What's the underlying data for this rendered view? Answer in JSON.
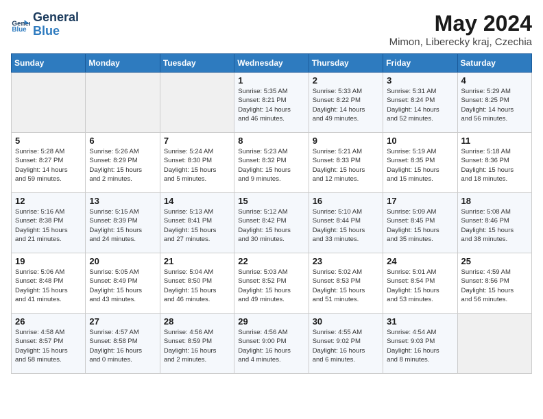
{
  "header": {
    "logo_line1": "General",
    "logo_line2": "Blue",
    "month_year": "May 2024",
    "location": "Mimon, Liberecky kraj, Czechia"
  },
  "weekdays": [
    "Sunday",
    "Monday",
    "Tuesday",
    "Wednesday",
    "Thursday",
    "Friday",
    "Saturday"
  ],
  "weeks": [
    [
      {
        "day": "",
        "info": ""
      },
      {
        "day": "",
        "info": ""
      },
      {
        "day": "",
        "info": ""
      },
      {
        "day": "1",
        "info": "Sunrise: 5:35 AM\nSunset: 8:21 PM\nDaylight: 14 hours\nand 46 minutes."
      },
      {
        "day": "2",
        "info": "Sunrise: 5:33 AM\nSunset: 8:22 PM\nDaylight: 14 hours\nand 49 minutes."
      },
      {
        "day": "3",
        "info": "Sunrise: 5:31 AM\nSunset: 8:24 PM\nDaylight: 14 hours\nand 52 minutes."
      },
      {
        "day": "4",
        "info": "Sunrise: 5:29 AM\nSunset: 8:25 PM\nDaylight: 14 hours\nand 56 minutes."
      }
    ],
    [
      {
        "day": "5",
        "info": "Sunrise: 5:28 AM\nSunset: 8:27 PM\nDaylight: 14 hours\nand 59 minutes."
      },
      {
        "day": "6",
        "info": "Sunrise: 5:26 AM\nSunset: 8:29 PM\nDaylight: 15 hours\nand 2 minutes."
      },
      {
        "day": "7",
        "info": "Sunrise: 5:24 AM\nSunset: 8:30 PM\nDaylight: 15 hours\nand 5 minutes."
      },
      {
        "day": "8",
        "info": "Sunrise: 5:23 AM\nSunset: 8:32 PM\nDaylight: 15 hours\nand 9 minutes."
      },
      {
        "day": "9",
        "info": "Sunrise: 5:21 AM\nSunset: 8:33 PM\nDaylight: 15 hours\nand 12 minutes."
      },
      {
        "day": "10",
        "info": "Sunrise: 5:19 AM\nSunset: 8:35 PM\nDaylight: 15 hours\nand 15 minutes."
      },
      {
        "day": "11",
        "info": "Sunrise: 5:18 AM\nSunset: 8:36 PM\nDaylight: 15 hours\nand 18 minutes."
      }
    ],
    [
      {
        "day": "12",
        "info": "Sunrise: 5:16 AM\nSunset: 8:38 PM\nDaylight: 15 hours\nand 21 minutes."
      },
      {
        "day": "13",
        "info": "Sunrise: 5:15 AM\nSunset: 8:39 PM\nDaylight: 15 hours\nand 24 minutes."
      },
      {
        "day": "14",
        "info": "Sunrise: 5:13 AM\nSunset: 8:41 PM\nDaylight: 15 hours\nand 27 minutes."
      },
      {
        "day": "15",
        "info": "Sunrise: 5:12 AM\nSunset: 8:42 PM\nDaylight: 15 hours\nand 30 minutes."
      },
      {
        "day": "16",
        "info": "Sunrise: 5:10 AM\nSunset: 8:44 PM\nDaylight: 15 hours\nand 33 minutes."
      },
      {
        "day": "17",
        "info": "Sunrise: 5:09 AM\nSunset: 8:45 PM\nDaylight: 15 hours\nand 35 minutes."
      },
      {
        "day": "18",
        "info": "Sunrise: 5:08 AM\nSunset: 8:46 PM\nDaylight: 15 hours\nand 38 minutes."
      }
    ],
    [
      {
        "day": "19",
        "info": "Sunrise: 5:06 AM\nSunset: 8:48 PM\nDaylight: 15 hours\nand 41 minutes."
      },
      {
        "day": "20",
        "info": "Sunrise: 5:05 AM\nSunset: 8:49 PM\nDaylight: 15 hours\nand 43 minutes."
      },
      {
        "day": "21",
        "info": "Sunrise: 5:04 AM\nSunset: 8:50 PM\nDaylight: 15 hours\nand 46 minutes."
      },
      {
        "day": "22",
        "info": "Sunrise: 5:03 AM\nSunset: 8:52 PM\nDaylight: 15 hours\nand 49 minutes."
      },
      {
        "day": "23",
        "info": "Sunrise: 5:02 AM\nSunset: 8:53 PM\nDaylight: 15 hours\nand 51 minutes."
      },
      {
        "day": "24",
        "info": "Sunrise: 5:01 AM\nSunset: 8:54 PM\nDaylight: 15 hours\nand 53 minutes."
      },
      {
        "day": "25",
        "info": "Sunrise: 4:59 AM\nSunset: 8:56 PM\nDaylight: 15 hours\nand 56 minutes."
      }
    ],
    [
      {
        "day": "26",
        "info": "Sunrise: 4:58 AM\nSunset: 8:57 PM\nDaylight: 15 hours\nand 58 minutes."
      },
      {
        "day": "27",
        "info": "Sunrise: 4:57 AM\nSunset: 8:58 PM\nDaylight: 16 hours\nand 0 minutes."
      },
      {
        "day": "28",
        "info": "Sunrise: 4:56 AM\nSunset: 8:59 PM\nDaylight: 16 hours\nand 2 minutes."
      },
      {
        "day": "29",
        "info": "Sunrise: 4:56 AM\nSunset: 9:00 PM\nDaylight: 16 hours\nand 4 minutes."
      },
      {
        "day": "30",
        "info": "Sunrise: 4:55 AM\nSunset: 9:02 PM\nDaylight: 16 hours\nand 6 minutes."
      },
      {
        "day": "31",
        "info": "Sunrise: 4:54 AM\nSunset: 9:03 PM\nDaylight: 16 hours\nand 8 minutes."
      },
      {
        "day": "",
        "info": ""
      }
    ]
  ]
}
